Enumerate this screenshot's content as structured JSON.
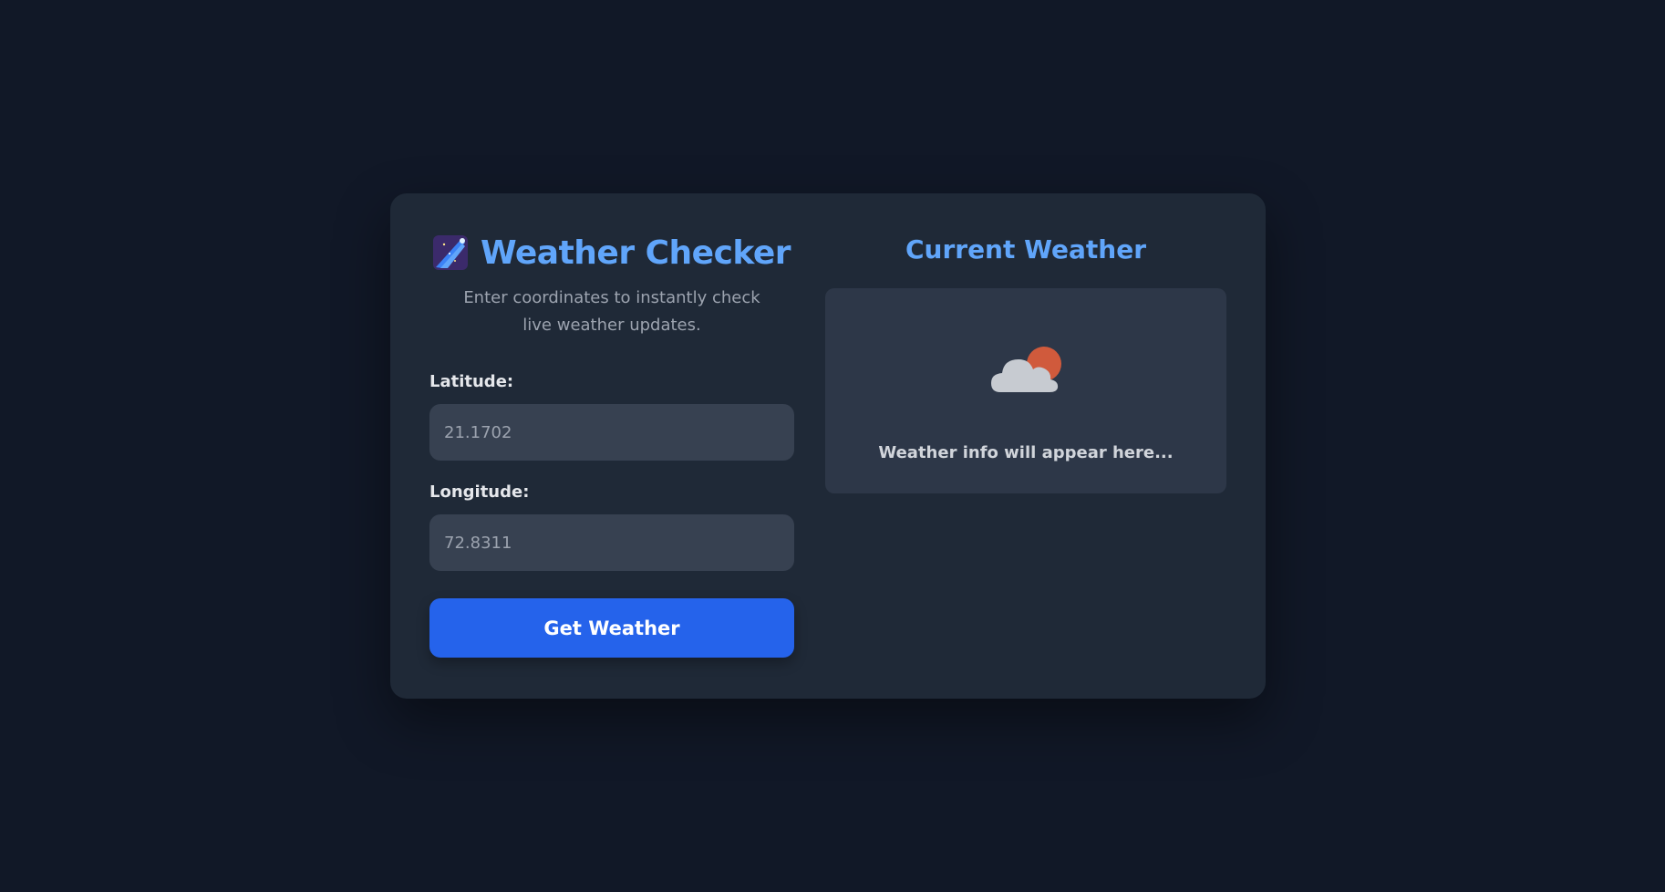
{
  "app": {
    "title": "Weather Checker",
    "title_icon": "comet-icon",
    "subtitle": "Enter coordinates to instantly check live weather updates."
  },
  "form": {
    "latitude_label": "Latitude:",
    "latitude_placeholder": "21.1702",
    "longitude_label": "Longitude:",
    "longitude_placeholder": "72.8311",
    "submit_label": "Get Weather"
  },
  "weather": {
    "heading": "Current Weather",
    "icon": "sun-behind-cloud-icon",
    "placeholder_message": "Weather info will appear here..."
  },
  "colors": {
    "page_background": "#111827",
    "card_background": "#1f2937",
    "accent": "#60a5fa",
    "button": "#2563eb",
    "input_background": "#374151"
  }
}
